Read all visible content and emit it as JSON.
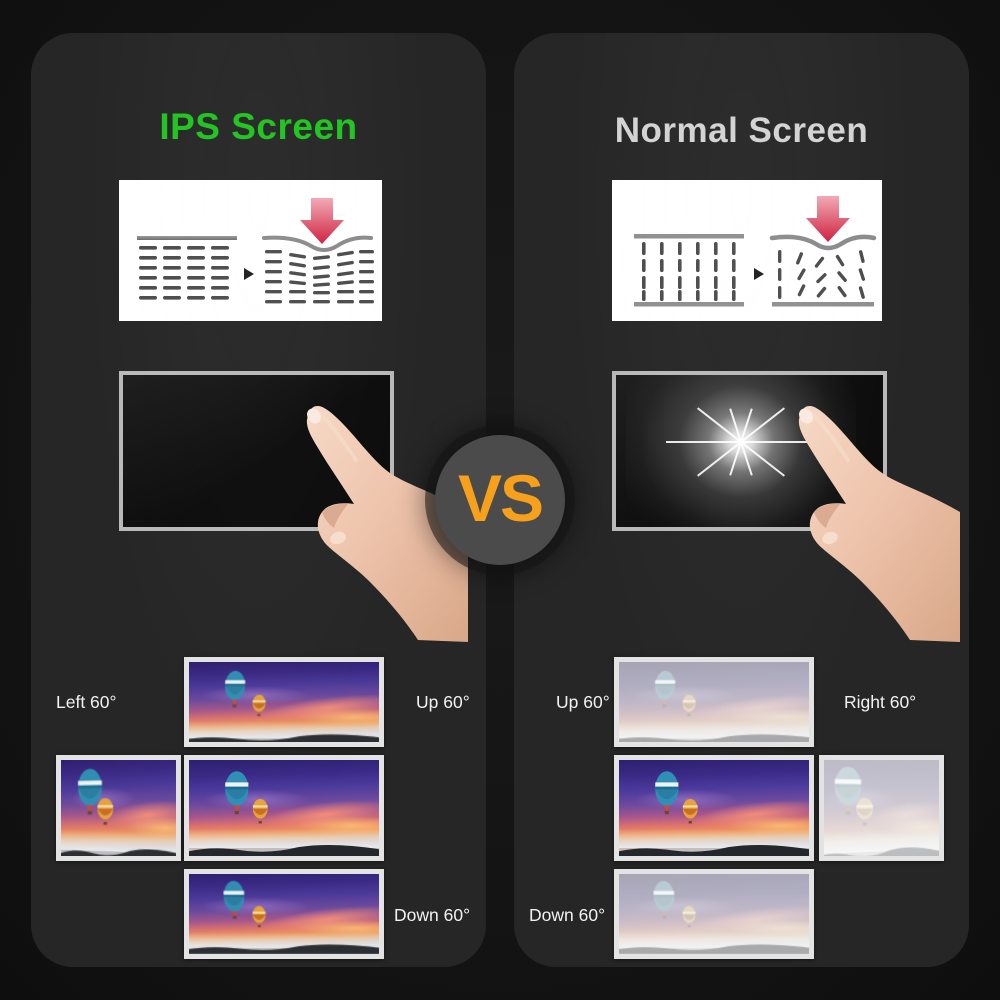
{
  "page": {
    "background_color": "#141414",
    "card_color": "#262626"
  },
  "panels": [
    {
      "id": "ips",
      "title": "IPS Screen",
      "title_color": "#22c522",
      "pressure_diagram": {
        "name": "ips-pressure-diagram",
        "before_label": "horizontal-aligned-crystals",
        "after_label": "crystals-bend-uniformly",
        "arrow_color": "#d9304a"
      },
      "touch_demo": {
        "name": "ips-touch-screen",
        "state": "no-ripple",
        "screen_color": "#0c0c0c",
        "bezel_color": "#b9b9b9"
      },
      "viewing_angles": [
        {
          "key": "left",
          "label": "Left 60°",
          "quality": "vivid"
        },
        {
          "key": "up",
          "label": "Up 60°",
          "quality": "vivid"
        },
        {
          "key": "center",
          "label": "",
          "quality": "vivid"
        },
        {
          "key": "down",
          "label": "Down 60°",
          "quality": "vivid"
        }
      ]
    },
    {
      "id": "normal",
      "title": "Normal Screen",
      "title_color": "#d4d4d4",
      "pressure_diagram": {
        "name": "normal-pressure-diagram",
        "before_label": "vertical-aligned-crystals",
        "after_label": "crystals-scatter-randomly",
        "arrow_color": "#d9304a"
      },
      "touch_demo": {
        "name": "normal-touch-screen",
        "state": "white-ripple-glow",
        "screen_color": "#0c0c0c",
        "bezel_color": "#b9b9b9"
      },
      "viewing_angles": [
        {
          "key": "up",
          "label": "Up 60°",
          "quality": "washed-out"
        },
        {
          "key": "right",
          "label": "Right 60°",
          "quality": "washed-out"
        },
        {
          "key": "center",
          "label": "",
          "quality": "vivid"
        },
        {
          "key": "down",
          "label": "Down 60°",
          "quality": "washed-out"
        }
      ]
    }
  ],
  "versus": {
    "label": "VS",
    "text_color": "#f6a01b",
    "circle_color": "#4b4b4b"
  }
}
